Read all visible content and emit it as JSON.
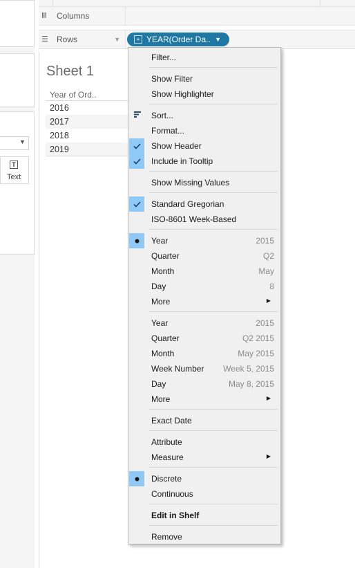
{
  "shelves": {
    "columns_label": "Columns",
    "rows_label": "Rows",
    "rows_pill": "YEAR(Order Da.."
  },
  "sheet": {
    "title": "Sheet 1",
    "column_header": "Year of Ord..",
    "rows": [
      "2016",
      "2017",
      "2018",
      "2019"
    ]
  },
  "marks": {
    "text_button_label": "Text"
  },
  "menu": {
    "filter": "Filter...",
    "show_filter": "Show Filter",
    "show_highlighter": "Show Highlighter",
    "sort": "Sort...",
    "format": "Format...",
    "show_header": "Show Header",
    "include_in_tooltip": "Include in Tooltip",
    "show_missing_values": "Show Missing Values",
    "standard_gregorian": "Standard Gregorian",
    "iso_week_based": "ISO-8601 Week-Based",
    "discrete_dates": [
      {
        "label": "Year",
        "hint": "2015"
      },
      {
        "label": "Quarter",
        "hint": "Q2"
      },
      {
        "label": "Month",
        "hint": "May"
      },
      {
        "label": "Day",
        "hint": "8"
      }
    ],
    "more_1": "More",
    "exact_dates": [
      {
        "label": "Year",
        "hint": "2015"
      },
      {
        "label": "Quarter",
        "hint": "Q2 2015"
      },
      {
        "label": "Month",
        "hint": "May 2015"
      },
      {
        "label": "Week Number",
        "hint": "Week 5, 2015"
      },
      {
        "label": "Day",
        "hint": "May 8, 2015"
      }
    ],
    "more_2": "More",
    "exact_date": "Exact Date",
    "attribute": "Attribute",
    "measure": "Measure",
    "discrete": "Discrete",
    "continuous": "Continuous",
    "edit_in_shelf": "Edit in Shelf",
    "remove": "Remove"
  },
  "colors": {
    "pill": "#1f77a4",
    "menu_background": "#f0f0f0",
    "check_highlight": "#90c8f6"
  }
}
